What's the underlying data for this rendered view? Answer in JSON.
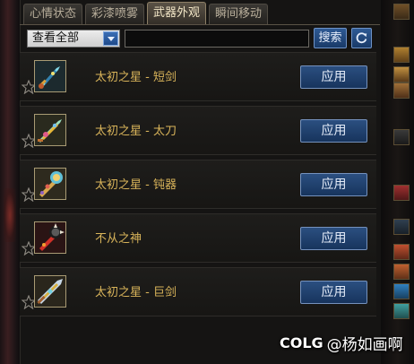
{
  "tabs": [
    {
      "label": "心情状态",
      "active": false
    },
    {
      "label": "彩漆喷雾",
      "active": false
    },
    {
      "label": "武器外观",
      "active": true
    },
    {
      "label": "瞬间移动",
      "active": false
    }
  ],
  "search": {
    "filter_value": "查看全部",
    "query_value": "",
    "button_label": "搜索"
  },
  "items": [
    {
      "name": "太初之星 - 短剑",
      "apply_label": "应用",
      "icon": "short-sword-icon"
    },
    {
      "name": "太初之星 - 太刀",
      "apply_label": "应用",
      "icon": "katana-icon"
    },
    {
      "name": "太初之星 - 钝器",
      "apply_label": "应用",
      "icon": "blunt-weapon-icon"
    },
    {
      "name": "不从之神",
      "apply_label": "应用",
      "icon": "mace-icon"
    },
    {
      "name": "太初之星 - 巨剑",
      "apply_label": "应用",
      "icon": "greatsword-icon"
    }
  ],
  "watermark": {
    "logo": "COLG",
    "text": "@杨如画啊"
  },
  "colors": {
    "item_name": "#d9b45a",
    "button_blue": "#1f4a8a",
    "panel_bg": "#151413"
  }
}
